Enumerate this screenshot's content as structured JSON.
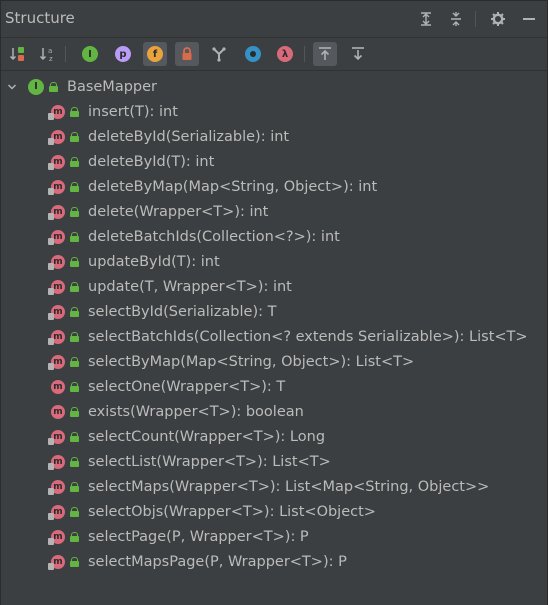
{
  "panel": {
    "title": "Structure"
  },
  "title_actions": [
    {
      "name": "expand-all-icon"
    },
    {
      "name": "collapse-all-icon"
    },
    {
      "name": "settings-icon"
    },
    {
      "name": "minimize-icon"
    }
  ],
  "toolbar": {
    "buttons": [
      {
        "name": "sort-by-visibility-icon"
      },
      {
        "name": "sort-alphabetically-icon",
        "label": "a/z"
      },
      {
        "name": "show-inherited-icon",
        "label": "I"
      },
      {
        "name": "show-properties-icon",
        "label": "p"
      },
      {
        "name": "show-fields-icon",
        "label": "f"
      },
      {
        "name": "show-non-public-icon"
      },
      {
        "name": "show-interfaces-icon"
      },
      {
        "name": "show-anonymous-classes-icon"
      },
      {
        "name": "show-lambdas-icon",
        "label": "λ"
      },
      {
        "name": "autoscroll-to-source-icon"
      },
      {
        "name": "autoscroll-from-source-icon"
      }
    ],
    "colors": {
      "inherited": "#62b543",
      "properties": "#b99bf8",
      "fields": "#e8a33d",
      "non_public": "#d96b4a",
      "anonymous": "#3592c4",
      "lambda": "#d86a7b"
    }
  },
  "tree": {
    "root": {
      "label": "BaseMapper",
      "icon_letter": "I"
    },
    "method_icon_letter": "m",
    "methods": [
      {
        "label": "insert(T): int",
        "pinned": true
      },
      {
        "label": "deleteById(Serializable): int",
        "pinned": true
      },
      {
        "label": "deleteById(T): int",
        "pinned": true
      },
      {
        "label": "deleteByMap(Map<String, Object>): int",
        "pinned": true
      },
      {
        "label": "delete(Wrapper<T>): int",
        "pinned": true
      },
      {
        "label": "deleteBatchIds(Collection<?>): int",
        "pinned": true
      },
      {
        "label": "updateById(T): int",
        "pinned": true
      },
      {
        "label": "update(T, Wrapper<T>): int",
        "pinned": true
      },
      {
        "label": "selectById(Serializable): T",
        "pinned": true
      },
      {
        "label": "selectBatchIds(Collection<? extends Serializable>): List<T>",
        "pinned": true
      },
      {
        "label": "selectByMap(Map<String, Object>): List<T>",
        "pinned": true
      },
      {
        "label": "selectOne(Wrapper<T>): T",
        "pinned": false
      },
      {
        "label": "exists(Wrapper<T>): boolean",
        "pinned": false
      },
      {
        "label": "selectCount(Wrapper<T>): Long",
        "pinned": true
      },
      {
        "label": "selectList(Wrapper<T>): List<T>",
        "pinned": true
      },
      {
        "label": "selectMaps(Wrapper<T>): List<Map<String, Object>>",
        "pinned": true
      },
      {
        "label": "selectObjs(Wrapper<T>): List<Object>",
        "pinned": true
      },
      {
        "label": "selectPage(P, Wrapper<T>): P",
        "pinned": true
      },
      {
        "label": "selectMapsPage(P, Wrapper<T>): P",
        "pinned": true
      }
    ]
  }
}
